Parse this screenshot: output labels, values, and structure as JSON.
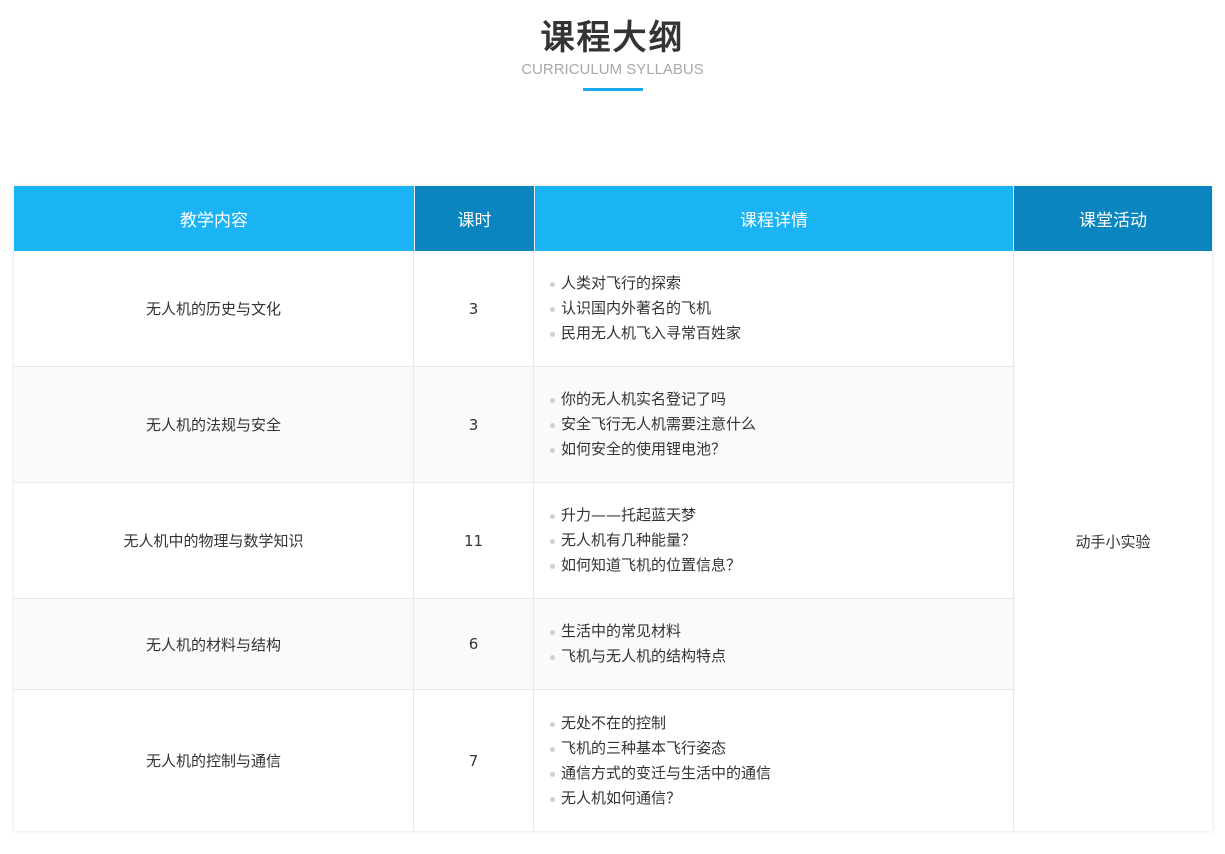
{
  "header": {
    "title": "课程大纲",
    "subtitle": "CURRICULUM SYLLABUS"
  },
  "table": {
    "columns": [
      "教学内容",
      "课时",
      "课程详情",
      "课堂活动"
    ],
    "activity": "动手小实验",
    "rows": [
      {
        "content": "无人机的历史与文化",
        "hours": "3",
        "details": [
          "人类对飞行的探索",
          "认识国内外著名的飞机",
          "民用无人机飞入寻常百姓家"
        ]
      },
      {
        "content": "无人机的法规与安全",
        "hours": "3",
        "details": [
          "你的无人机实名登记了吗",
          "安全飞行无人机需要注意什么",
          "如何安全的使用锂电池？"
        ]
      },
      {
        "content": "无人机中的物理与数学知识",
        "hours": "11",
        "details": [
          "升力——托起蓝天梦",
          "无人机有几种能量？",
          "如何知道飞机的位置信息？"
        ]
      },
      {
        "content": "无人机的材料与结构",
        "hours": "6",
        "details": [
          "生活中的常见材料",
          "飞机与无人机的结构特点"
        ]
      },
      {
        "content": "无人机的控制与通信",
        "hours": "7",
        "details": [
          "无处不在的控制",
          "飞机的三种基本飞行姿态",
          "通信方式的变迁与生活中的通信",
          "无人机如何通信？"
        ]
      }
    ]
  }
}
